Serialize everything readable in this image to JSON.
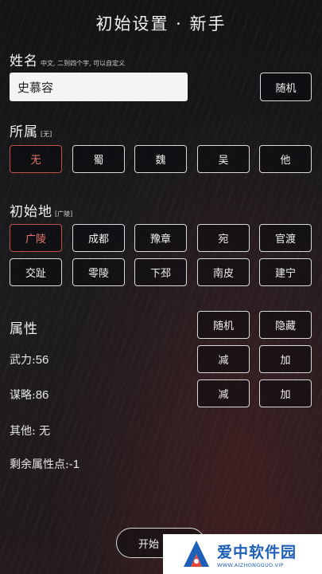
{
  "header": {
    "title": "初始设置 · 新手"
  },
  "name_section": {
    "label": "姓名",
    "hint": "中文, 二到四个字, 可以自定义",
    "value": "史慕容",
    "random_label": "随机"
  },
  "faction_section": {
    "label": "所属",
    "hint": "[无]",
    "options": [
      "无",
      "蜀",
      "魏",
      "吴",
      "他"
    ],
    "selected": "无"
  },
  "origin_section": {
    "label": "初始地",
    "hint": "[广陵]",
    "options": [
      "广陵",
      "成都",
      "豫章",
      "宛",
      "官渡",
      "交趾",
      "零陵",
      "下邳",
      "南皮",
      "建宁"
    ],
    "selected": "广陵"
  },
  "attributes": {
    "label": "属性",
    "random_label": "随机",
    "hide_label": "隐藏",
    "minus_label": "减",
    "plus_label": "加",
    "force_label": "武力:",
    "force_value": "56",
    "strategy_label": "谋略:",
    "strategy_value": "86",
    "other_text": "其他: 无",
    "remaining_label": "剩余属性点:",
    "remaining_value": "-1"
  },
  "footer": {
    "start_label": "开始"
  },
  "watermark": {
    "cn": "爱中软件园",
    "en": "WWW.AIZHONGGUO.VIP",
    "color": "#1e5fb8"
  },
  "colors": {
    "accent_selected": "#c0504a",
    "border": "#d9d9d9"
  }
}
